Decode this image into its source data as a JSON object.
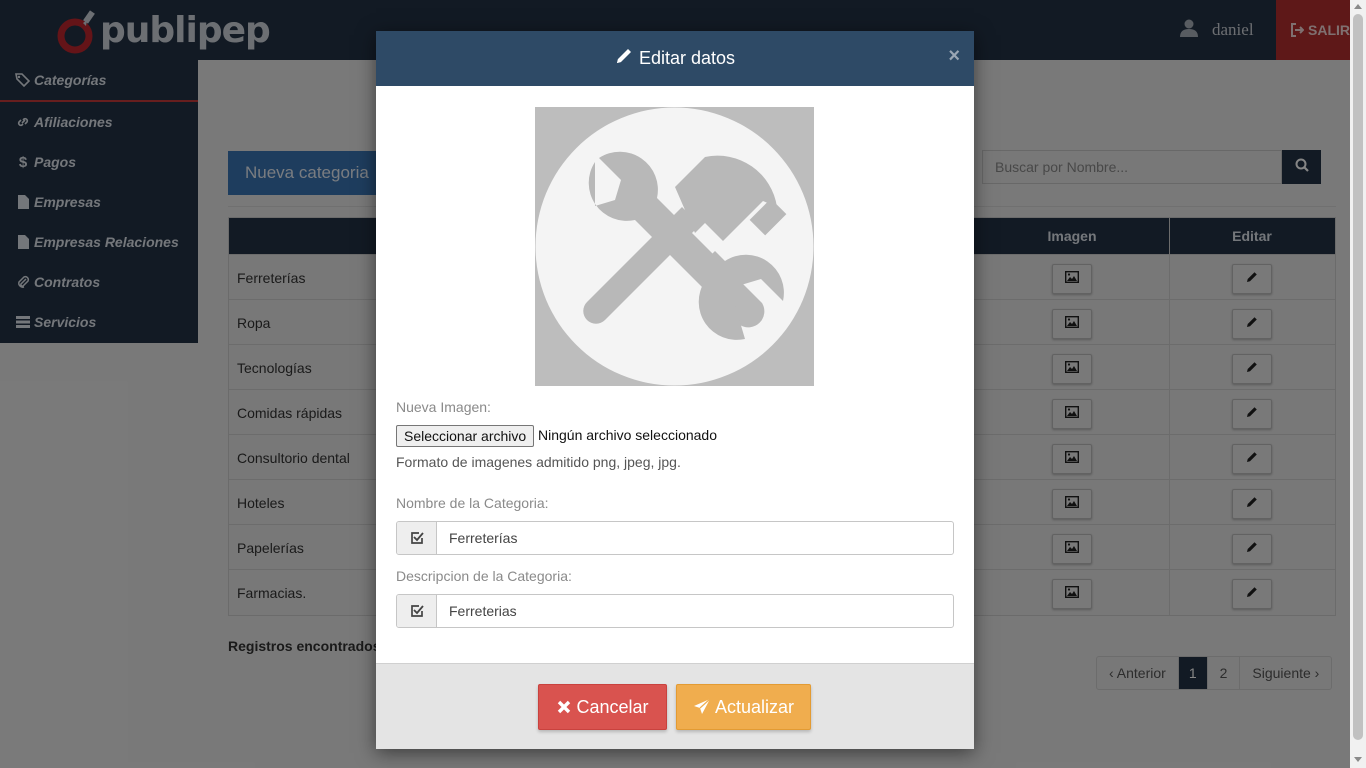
{
  "app": {
    "brand": "publipep"
  },
  "header": {
    "user_name": "daniel",
    "logout_label": "SALIR"
  },
  "sidebar": {
    "items": [
      {
        "label": "Categorías",
        "icon": "tags-icon"
      },
      {
        "label": "Afiliaciones",
        "icon": "link-icon"
      },
      {
        "label": "Pagos",
        "icon": "dollar-icon"
      },
      {
        "label": "Empresas",
        "icon": "file-icon"
      },
      {
        "label": "Empresas Relaciones",
        "icon": "file-icon"
      },
      {
        "label": "Contratos",
        "icon": "paperclip-icon"
      },
      {
        "label": "Servicios",
        "icon": "server-icon"
      }
    ]
  },
  "main": {
    "new_button": "Nueva categoria",
    "search_placeholder": "Buscar por Nombre...",
    "table": {
      "headers": {
        "image": "Imagen",
        "edit": "Editar"
      },
      "rows": [
        "Ferreterías",
        "Ropa",
        "Tecnologías",
        "Comidas rápidas",
        "Consultorio dental",
        "Hoteles",
        "Papelerías",
        "Farmacias."
      ]
    },
    "records_label": "Registros encontrados",
    "pagination": {
      "prev": "‹ Anterior",
      "pages": [
        "1",
        "2"
      ],
      "active": "1",
      "next": "Siguiente ›"
    }
  },
  "modal": {
    "title": "Editar datos",
    "close": "×",
    "new_image_label": "Nueva Imagen:",
    "file_button": "Seleccionar archivo",
    "file_status": "Ningún archivo seleccionado",
    "format_hint": "Formato de imagenes admitido png, jpeg, jpg.",
    "name_label": "Nombre de la Categoria:",
    "name_value": "Ferreterías",
    "description_label": "Descripcion de la Categoria:",
    "description_value": "Ferreterias",
    "cancel_label": "Cancelar",
    "update_label": "Actualizar"
  },
  "colors": {
    "navy": "#233245",
    "modal_header": "#2e4a66",
    "danger": "#d9534f",
    "warning": "#f0ad4e",
    "primary": "#3a76b5"
  }
}
